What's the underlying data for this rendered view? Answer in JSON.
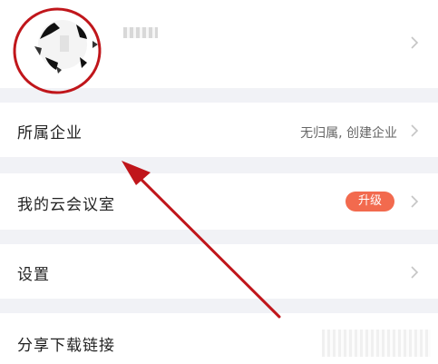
{
  "profile": {
    "avatar_icon": "avatar-icon",
    "chevron_icon": "chevron-right-icon"
  },
  "menu": {
    "enterprise": {
      "label": "所属企业",
      "value": "无归属, 创建企业"
    },
    "meeting_room": {
      "label": "我的云会议室",
      "badge": "升级"
    },
    "settings": {
      "label": "设置"
    },
    "share": {
      "label": "分享下载链接"
    }
  },
  "annotation": {
    "circle_color": "#c0161b",
    "arrow_color": "#c0161b"
  },
  "colors": {
    "badge": "#f26a4e",
    "divider": "#f1f2f6"
  }
}
